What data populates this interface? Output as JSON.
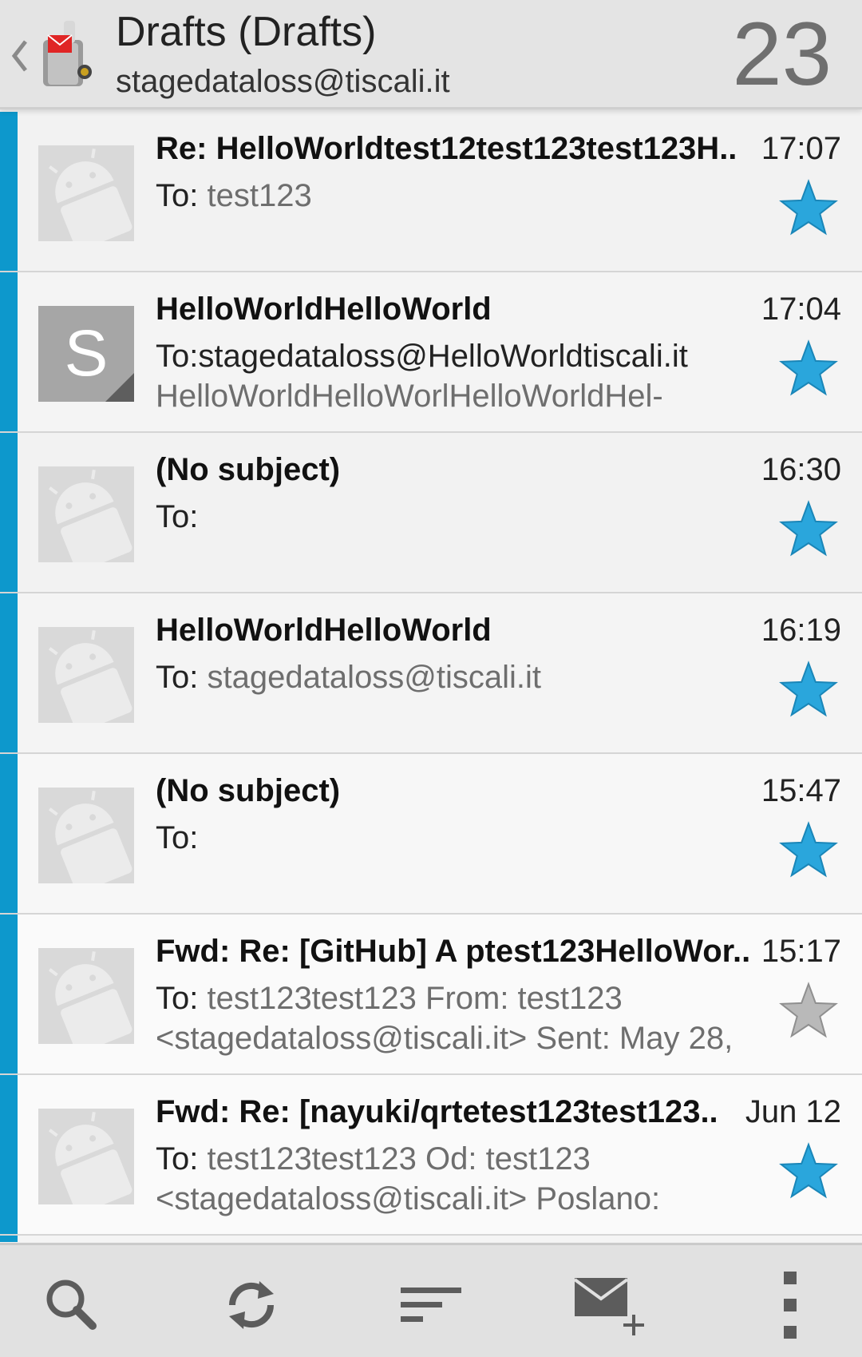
{
  "header": {
    "folder_title": "Drafts (Drafts)",
    "account_email": "stagedataloss@tiscali.it",
    "unread_count": "23"
  },
  "messages": [
    {
      "subject": "Re: HelloWorldtest12test123test123H..",
      "time": "17:07",
      "to_label": "To:",
      "to_value": " test123",
      "preview": "",
      "starred": true,
      "avatar": "android",
      "unread": true
    },
    {
      "subject": "HelloWorldHelloWorld",
      "time": "17:04",
      "to_label": "To:",
      "to_value": "stagedataloss@HelloWorldtiscali.it",
      "preview": "HelloWorldHelloWorlHelloWorldHel-",
      "starred": true,
      "avatar": "S",
      "unread": true
    },
    {
      "subject": "(No subject)",
      "time": "16:30",
      "to_label": "To:",
      "to_value": "",
      "preview": "",
      "starred": true,
      "avatar": "android",
      "unread": true
    },
    {
      "subject": "HelloWorldHelloWorld",
      "time": "16:19",
      "to_label": "To:",
      "to_value": " stagedataloss@tiscali.it",
      "preview": "",
      "starred": true,
      "avatar": "android",
      "unread": true
    },
    {
      "subject": "(No subject)",
      "time": "15:47",
      "to_label": "To:",
      "to_value": "",
      "preview": "",
      "starred": true,
      "avatar": "android",
      "unread": true
    },
    {
      "subject": "Fwd: Re: [GitHub] A ptest123HelloWor..",
      "time": "15:17",
      "to_label": "To:",
      "to_value": " test123test123 From: test123",
      "preview": "<stagedataloss@tiscali.it> Sent: May 28,",
      "starred": false,
      "avatar": "android",
      "unread": true
    },
    {
      "subject": "Fwd: Re: [nayuki/qrtetest123test123..",
      "time": "Jun 12",
      "to_label": "To:",
      "to_value": " test123test123 Od: test123",
      "preview": "<stagedataloss@tiscali.it> Poslano:",
      "starred": true,
      "avatar": "android",
      "unread": true
    }
  ],
  "colors": {
    "accent": "#0d98cc",
    "star_on": "#2aa6dc",
    "star_off": "#b9b9b9"
  },
  "toolbar": {
    "icons": [
      "search-icon",
      "refresh-icon",
      "sort-icon",
      "compose-icon",
      "overflow-menu-icon"
    ]
  }
}
